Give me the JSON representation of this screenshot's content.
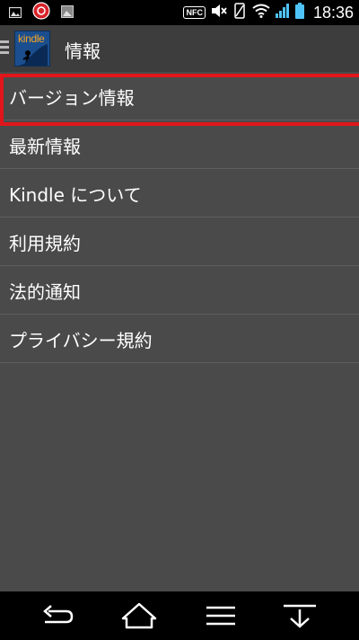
{
  "status_bar": {
    "time": "18:36",
    "nfc_label": "NFC",
    "left_icons": [
      "image-icon",
      "app-notification-icon",
      "photo-icon"
    ],
    "right_icons": [
      "nfc-icon",
      "mute-icon",
      "vibrate-icon",
      "wifi-icon",
      "signal-icon",
      "battery-icon"
    ]
  },
  "action_bar": {
    "title": "情報",
    "logo_text": "kindle",
    "accent_color": "#f5a623"
  },
  "menu": {
    "items": [
      {
        "label": "バージョン情報",
        "selected": true
      },
      {
        "label": "最新情報"
      },
      {
        "label": "Kindle について"
      },
      {
        "label": "利用規約"
      },
      {
        "label": "法的通知"
      },
      {
        "label": "プライバシー規約"
      }
    ],
    "highlight_color": "#e0161b"
  },
  "nav_bar": {
    "buttons": [
      "back-icon",
      "home-icon",
      "menu-icon",
      "notification-pulldown-icon"
    ]
  }
}
